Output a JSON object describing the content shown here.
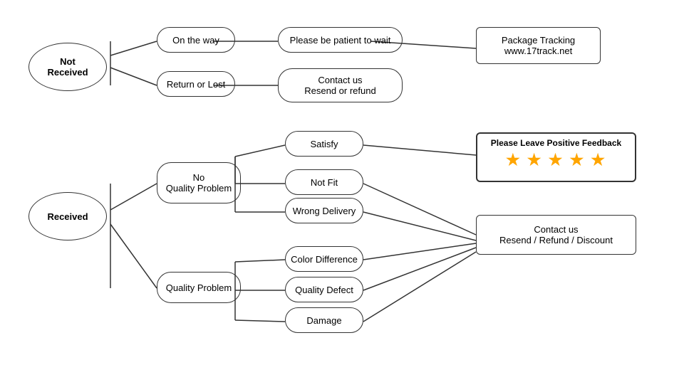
{
  "nodes": {
    "not_received": {
      "label": "Not\nReceived"
    },
    "on_the_way": {
      "label": "On the way"
    },
    "patient_wait": {
      "label": "Please be patient to wait"
    },
    "package_tracking": {
      "label": "Package Tracking\nwww.17track.net"
    },
    "return_or_lost": {
      "label": "Return or Lost"
    },
    "contact_resend_refund": {
      "label": "Contact us\nResend or refund"
    },
    "received": {
      "label": "Received"
    },
    "no_quality_problem": {
      "label": "No\nQuality Problem"
    },
    "satisfy": {
      "label": "Satisfy"
    },
    "not_fit": {
      "label": "Not Fit"
    },
    "wrong_delivery": {
      "label": "Wrong Delivery"
    },
    "quality_problem": {
      "label": "Quality Problem"
    },
    "color_difference": {
      "label": "Color Difference"
    },
    "quality_defect": {
      "label": "Quality Defect"
    },
    "damage": {
      "label": "Damage"
    },
    "feedback": {
      "label": "Please Leave Positive Feedback",
      "stars": "★ ★ ★ ★ ★"
    },
    "contact_resend_refund_discount": {
      "label": "Contact us\nResend / Refund / Discount"
    }
  }
}
